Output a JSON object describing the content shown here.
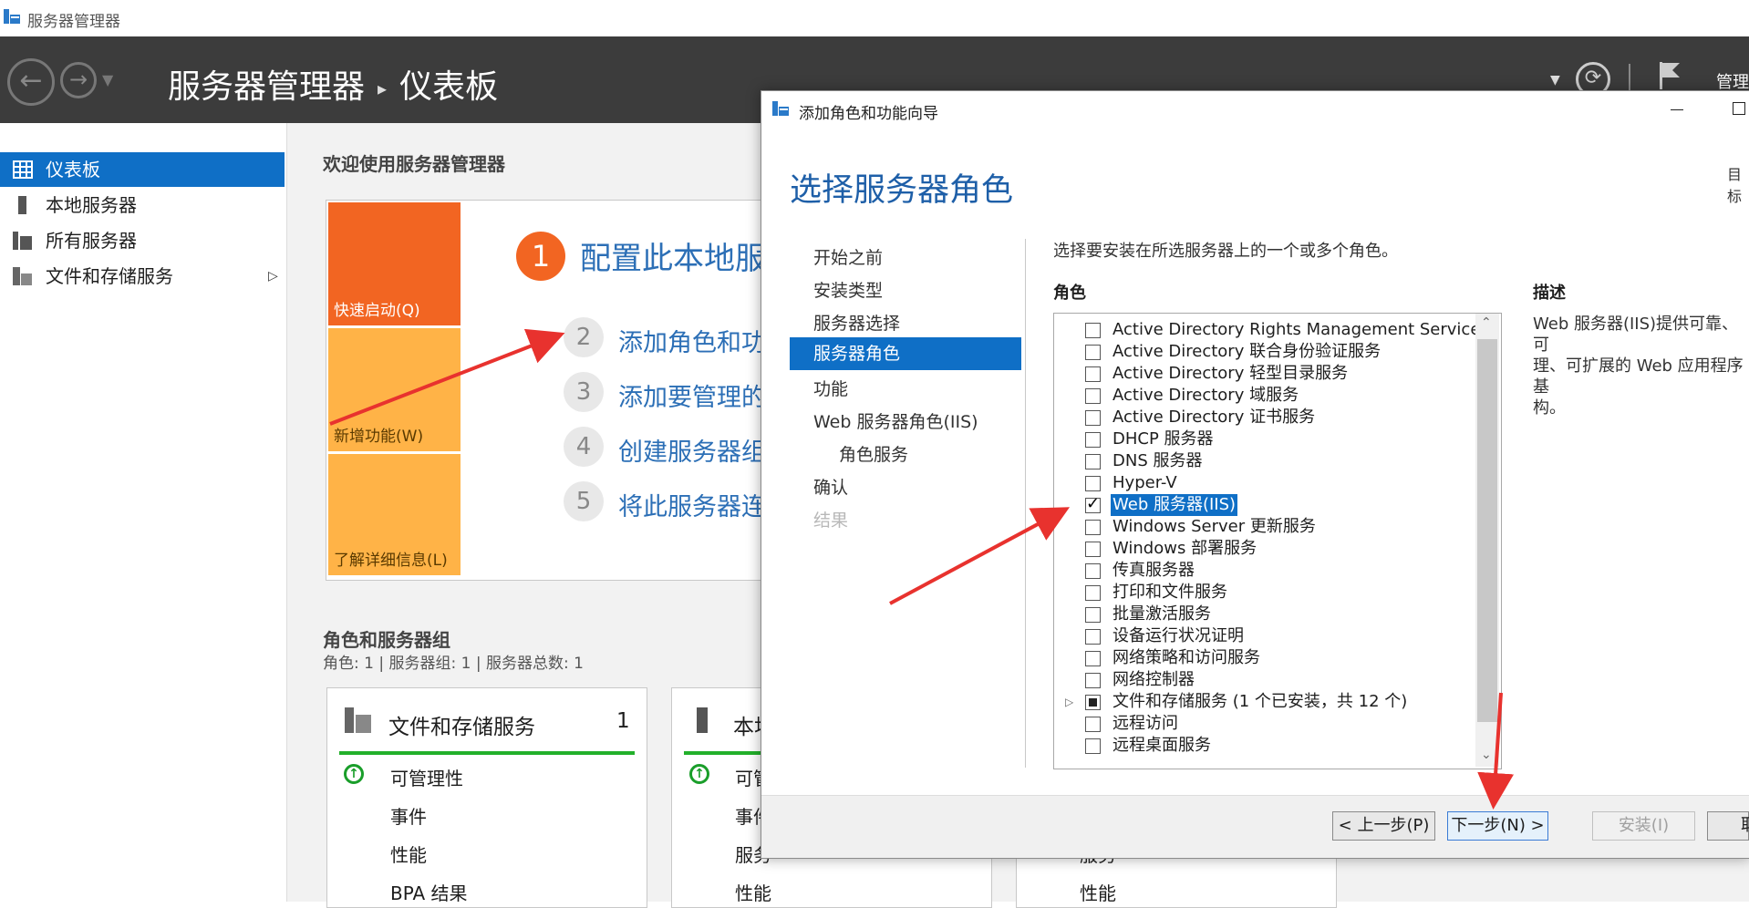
{
  "window": {
    "title": "服务器管理器"
  },
  "header": {
    "breadcrumb_root": "服务器管理器",
    "breadcrumb_current": "仪表板",
    "right_menu": "管理"
  },
  "sidebar": {
    "items": [
      {
        "label": "仪表板"
      },
      {
        "label": "本地服务器"
      },
      {
        "label": "所有服务器"
      },
      {
        "label": "文件和存储服务"
      }
    ]
  },
  "main": {
    "welcome": "欢迎使用服务器管理器",
    "tiles": [
      "快速启动(Q)",
      "新增功能(W)",
      "了解详细信息(L)"
    ],
    "steps": [
      {
        "num": "1",
        "text": "配置此本地服"
      },
      {
        "num": "2",
        "text": "添加角色和功"
      },
      {
        "num": "3",
        "text": "添加要管理的"
      },
      {
        "num": "4",
        "text": "创建服务器组"
      },
      {
        "num": "5",
        "text": "将此服务器连"
      }
    ],
    "roles_title": "角色和服务器组",
    "roles_sub": "角色: 1 | 服务器组: 1 | 服务器总数: 1",
    "card1": {
      "title": "文件和存储服务",
      "count": "1",
      "items": [
        "可管理性",
        "事件",
        "性能",
        "BPA 结果"
      ]
    },
    "card2": {
      "title": "本地",
      "items": [
        "可管",
        "事件",
        "服务",
        "性能"
      ]
    },
    "card3": {
      "items": [
        "服务",
        "性能"
      ]
    }
  },
  "dialog": {
    "title": "添加角色和功能向导",
    "heading": "选择服务器角色",
    "target_label": "目标",
    "steps": [
      "开始之前",
      "安装类型",
      "服务器选择",
      "服务器角色",
      "功能",
      "Web 服务器角色(IIS)",
      "角色服务",
      "确认",
      "结果"
    ],
    "instruction": "选择要安装在所选服务器上的一个或多个角色。",
    "roles_label": "角色",
    "description_label": "描述",
    "description_lines": [
      "Web 服务器(IIS)提供可靠、可",
      "理、可扩展的 Web 应用程序基",
      "构。"
    ],
    "roles": [
      "Active Directory Rights Management Services",
      "Active Directory 联合身份验证服务",
      "Active Directory 轻型目录服务",
      "Active Directory 域服务",
      "Active Directory 证书服务",
      "DHCP 服务器",
      "DNS 服务器",
      "Hyper-V",
      "Web 服务器(IIS)",
      "Windows Server 更新服务",
      "Windows 部署服务",
      "传真服务器",
      "打印和文件服务",
      "批量激活服务",
      "设备运行状况证明",
      "网络策略和访问服务",
      "网络控制器",
      "文件和存储服务 (1 个已安装，共 12 个)",
      "远程访问",
      "远程桌面服务"
    ],
    "buttons": {
      "prev": "< 上一步(P)",
      "next": "下一步(N) >",
      "install": "安装(I)",
      "cancel": "取"
    }
  },
  "colors": {
    "accent": "#0f6fc6",
    "tile_orange": "#f26522",
    "tile_amber": "#ffb347",
    "header_bg": "#3c3c3c",
    "annotation_red": "#e8322e"
  }
}
